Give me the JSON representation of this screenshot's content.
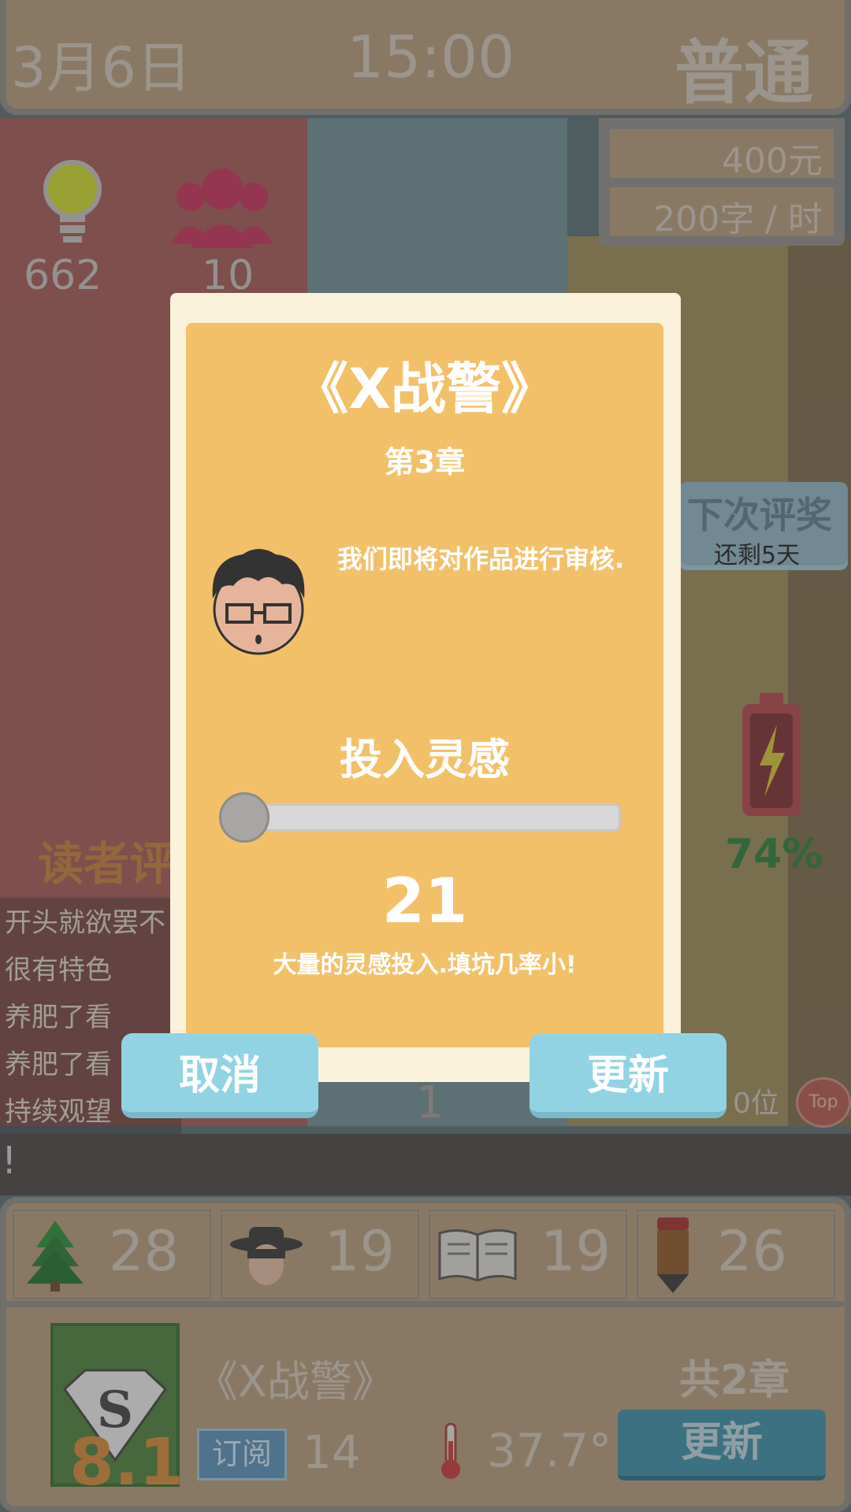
{
  "top_bar": {
    "date": "3月6日",
    "time": "15:00",
    "mode": "普通"
  },
  "resources": {
    "money": "400元",
    "speed": "200字 / 时"
  },
  "stats": {
    "inspiration": "662",
    "fans": "10"
  },
  "reader_comments": {
    "title": "读者评",
    "items": [
      "开头就欲罢不",
      "很有特色",
      "养肥了看",
      "养肥了看",
      "持续观望"
    ]
  },
  "award": {
    "title": "下次评奖",
    "remaining": "还剩5天"
  },
  "battery": {
    "percent": "74%",
    "level": 0.74
  },
  "overlay": {
    "strip_text": "!",
    "rank_text": "0位",
    "top_label": "Top",
    "page": "1"
  },
  "bottom_stats": [
    {
      "icon": "tree-icon",
      "value": "28"
    },
    {
      "icon": "hat-person-icon",
      "value": "19"
    },
    {
      "icon": "open-book-icon",
      "value": "19"
    },
    {
      "icon": "pencil-icon",
      "value": "26"
    }
  ],
  "book": {
    "score": "8.1",
    "title": "《X战警》",
    "chapters": "共2章",
    "subscribe_label": "订阅",
    "subscribers": "14",
    "temperature": "37.7°",
    "update_label": "更新"
  },
  "modal": {
    "title": "《X战警》",
    "chapter": "第3章",
    "message": "我们即将对作品进行审核.",
    "label": "投入灵感",
    "slider_value": "21",
    "slider_fraction": 0.0,
    "hint": "大量的灵感投入.填坑几率小!",
    "cancel_label": "取消",
    "update_label": "更新"
  },
  "colors": {
    "accent": "#f3c06a",
    "button": "#92d3e3",
    "panel": "#b39a7a"
  }
}
